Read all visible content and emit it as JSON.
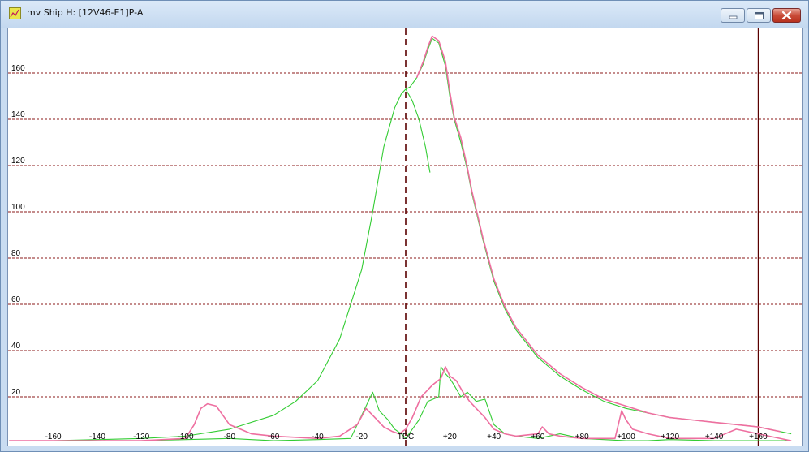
{
  "window": {
    "title": "mv Ship H: [12V46-E1]P-A",
    "minimize_label": "minimize",
    "maximize_label": "maximize",
    "close_label": "close"
  },
  "colors": {
    "grid": "#8b1a1a",
    "pressure_green": "#33cc33",
    "pressure_pink": "#ee6fa0",
    "tdc_line": "#5a0000",
    "frame": "#c9dcf1"
  },
  "icons": [
    "app-icon",
    "minimize-icon",
    "maximize-icon",
    "close-icon"
  ],
  "chart_data": {
    "type": "line",
    "title": "",
    "xlabel": "",
    "ylabel": "",
    "xlim": [
      -180,
      175
    ],
    "ylim": [
      0,
      180
    ],
    "y_ticks": [
      20,
      40,
      60,
      80,
      100,
      120,
      140,
      160
    ],
    "x_ticks": [
      {
        "value": -160,
        "label": "-160"
      },
      {
        "value": -140,
        "label": "-140"
      },
      {
        "value": -120,
        "label": "-120"
      },
      {
        "value": -100,
        "label": "-100"
      },
      {
        "value": -80,
        "label": "-80"
      },
      {
        "value": -60,
        "label": "-60"
      },
      {
        "value": -40,
        "label": "-40"
      },
      {
        "value": -20,
        "label": "-20"
      },
      {
        "value": 0,
        "label": "TDC"
      },
      {
        "value": 20,
        "label": "+20"
      },
      {
        "value": 40,
        "label": "+40"
      },
      {
        "value": 60,
        "label": "+60"
      },
      {
        "value": 80,
        "label": "+80"
      },
      {
        "value": 100,
        "label": "+100"
      },
      {
        "value": 120,
        "label": "+120"
      },
      {
        "value": 140,
        "label": "+140"
      },
      {
        "value": 160,
        "label": "+160"
      }
    ],
    "grid": true,
    "markers": [
      {
        "x": 0,
        "style": "dashed"
      },
      {
        "x": 160,
        "style": "solid"
      }
    ],
    "series": [
      {
        "color": "#33cc33",
        "x": [
          -180,
          -160,
          -140,
          -120,
          -100,
          -80,
          -60,
          -50,
          -40,
          -30,
          -20,
          -15,
          -10,
          -5,
          -2,
          0,
          2,
          5,
          8,
          10,
          12,
          15,
          18,
          20,
          22,
          25,
          28,
          30,
          35,
          40,
          45,
          50,
          60,
          70,
          80,
          90,
          100,
          110,
          120,
          130,
          140,
          150,
          160,
          170,
          175
        ],
        "y": [
          1,
          1,
          1.5,
          2,
          3,
          6,
          12,
          18,
          27,
          45,
          75,
          100,
          128,
          145,
          151,
          153,
          154,
          158,
          164,
          170,
          175,
          173,
          163,
          150,
          140,
          130,
          118,
          108,
          88,
          70,
          58,
          49,
          37,
          29,
          23,
          18,
          15,
          13,
          11,
          10,
          9,
          8,
          7,
          5,
          4
        ]
      },
      {
        "color": "#33cc33",
        "x": [
          0,
          3,
          6,
          9,
          11
        ],
        "y": [
          153,
          148,
          140,
          128,
          117
        ]
      },
      {
        "color": "#ee6fa0",
        "x": [
          5,
          8,
          10,
          12,
          15,
          18,
          20,
          22,
          25,
          28,
          30,
          35,
          40,
          45,
          50,
          60,
          70,
          80,
          90,
          100,
          110,
          120,
          130,
          140,
          150,
          160,
          170
        ],
        "y": [
          158,
          165,
          171,
          176,
          174,
          165,
          152,
          141,
          132,
          119,
          109,
          89,
          71,
          59,
          50,
          38,
          30,
          24,
          19,
          16,
          13,
          11,
          10,
          9,
          8,
          7,
          5
        ]
      },
      {
        "color": "#33cc33",
        "x": [
          -180,
          -120,
          -100,
          -80,
          -60,
          -40,
          -25,
          -20,
          -15,
          -12,
          -8,
          -5,
          -2,
          0,
          3,
          6,
          10,
          15,
          16,
          18,
          20,
          22,
          25,
          28,
          32,
          36,
          40,
          45,
          50,
          60,
          70,
          80,
          90,
          100,
          110,
          120,
          140,
          160,
          175
        ],
        "y": [
          1,
          1,
          1.5,
          2,
          1,
          1.5,
          2,
          12,
          22,
          14,
          10,
          6,
          4,
          2,
          6,
          10,
          18,
          20,
          33,
          30,
          28,
          25,
          20,
          22,
          18,
          19,
          8,
          4,
          3,
          2,
          4,
          2,
          1.5,
          1,
          1,
          1.5,
          1,
          1,
          1
        ]
      },
      {
        "color": "#ee6fa0",
        "x": [
          -180,
          -120,
          -100,
          -96,
          -93,
          -90,
          -86,
          -83,
          -80,
          -75,
          -70,
          -60,
          -40,
          -30,
          -22,
          -18,
          -14,
          -10,
          -6,
          -3,
          0,
          3,
          7,
          12,
          16,
          18,
          20,
          23,
          26,
          29,
          32,
          36,
          40,
          45,
          50,
          60,
          62,
          65,
          70,
          80,
          95,
          98,
          100,
          103,
          110,
          120,
          140,
          150,
          160,
          175
        ],
        "y": [
          1,
          1,
          2,
          8,
          15,
          17,
          16,
          12,
          8,
          6,
          4,
          3,
          2,
          3,
          8,
          15,
          11,
          7,
          5,
          4,
          6,
          11,
          20,
          25,
          28,
          33,
          29,
          27,
          22,
          18,
          15,
          11,
          6,
          4,
          3,
          4,
          7,
          4,
          3,
          2,
          2,
          14,
          10,
          6,
          4,
          2,
          2,
          6,
          4,
          1
        ]
      }
    ]
  }
}
